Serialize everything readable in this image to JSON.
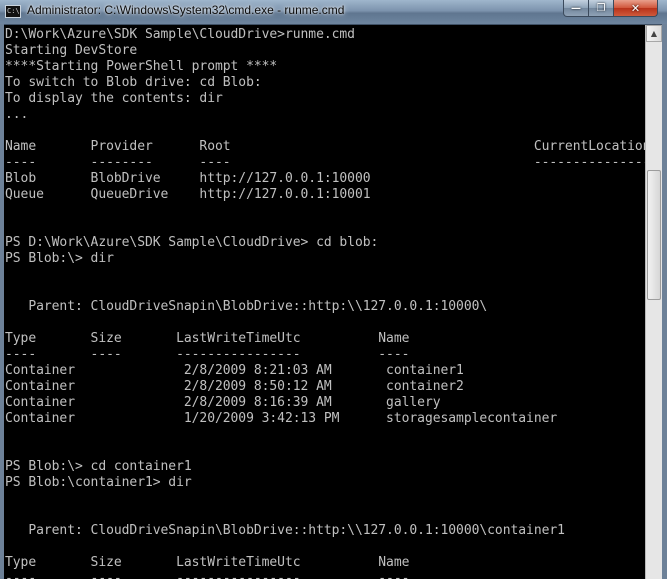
{
  "window": {
    "title": "Administrator: C:\\Windows\\System32\\cmd.exe - runme.cmd",
    "icon": "cmd-icon",
    "icon_text": "C:\\",
    "buttons": {
      "minimize": "minimize-icon",
      "maximize": "maximize-icon",
      "close": "close-icon"
    }
  },
  "colors": {
    "console_bg": "#000000",
    "console_fg": "#c0c0c0",
    "titlebar": "#7c93ad"
  },
  "console": {
    "lines": [
      "D:\\Work\\Azure\\SDK Sample\\CloudDrive>runme.cmd",
      "Starting DevStore",
      "****Starting PowerShell prompt ****",
      "To switch to Blob drive: cd Blob:",
      "To display the contents: dir",
      "...",
      "",
      "Name       Provider      Root                                       CurrentLocation",
      "----       --------      ----                                       ---------------",
      "Blob       BlobDrive     http://127.0.0.1:10000",
      "Queue      QueueDrive    http://127.0.0.1:10001",
      "",
      "",
      "PS D:\\Work\\Azure\\SDK Sample\\CloudDrive> cd blob:",
      "PS Blob:\\> dir",
      "",
      "",
      "   Parent: CloudDriveSnapin\\BlobDrive::http:\\\\127.0.0.1:10000\\",
      "",
      "Type       Size       LastWriteTimeUtc          Name",
      "----       ----       ----------------          ----",
      "Container              2/8/2009 8:21:03 AM       container1",
      "Container              2/8/2009 8:50:12 AM       container2",
      "Container              2/8/2009 8:16:39 AM       gallery",
      "Container              1/20/2009 3:42:13 PM      storagesamplecontainer",
      "",
      "",
      "PS Blob:\\> cd container1",
      "PS Blob:\\container1> dir",
      "",
      "",
      "   Parent: CloudDriveSnapin\\BlobDrive::http:\\\\127.0.0.1:10000\\container1",
      "",
      "Type       Size       LastWriteTimeUtc          Name",
      "----       ----       ----------------          ----"
    ]
  },
  "scrollbar": {
    "up_arrow": "up-arrow-icon",
    "up_glyph": "▲"
  }
}
